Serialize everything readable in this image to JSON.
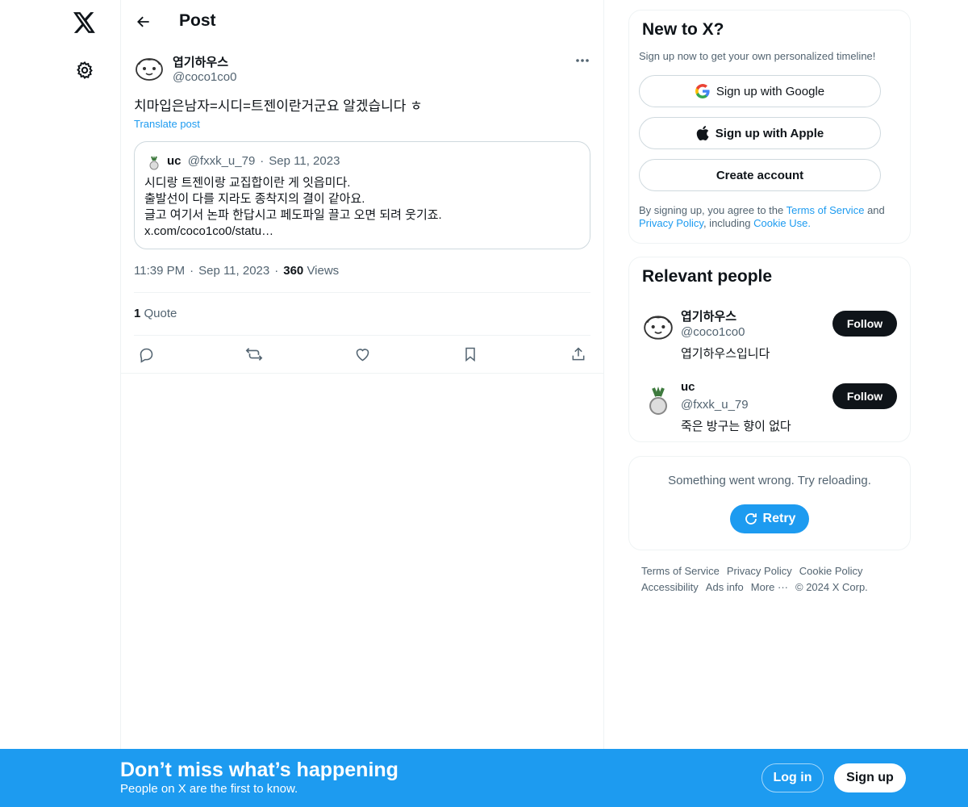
{
  "nav": {
    "logo_icon": "x-logo-icon",
    "settings_icon": "gear-icon"
  },
  "header": {
    "title": "Post"
  },
  "post": {
    "author_name": "엽기하우스",
    "author_handle": "@coco1co0",
    "text": "치마입은남자=시디=트젠이란거군요 알겠습니다 ㅎ",
    "translate": "Translate post",
    "quote": {
      "name": "uc",
      "handle": "@fxxk_u_79",
      "date": "Sep 11, 2023",
      "lines": [
        "시디랑 트젠이랑 교집합이란 게 잇읍미다.",
        "출발선이 다를 지라도 종착지의 결이 같아요.",
        "글고 여기서 논파 한답시고 페도파일 끌고 오면 되려 웃기죠.",
        "x.com/coco1co0/statu…"
      ]
    },
    "time": "11:39 PM",
    "date": "Sep 11, 2023",
    "views_count": "360",
    "views_label": "Views",
    "quotes_count": "1",
    "quotes_label": "Quote"
  },
  "signup_card": {
    "title": "New to X?",
    "subtitle": "Sign up now to get your own personalized timeline!",
    "google": "Sign up with Google",
    "apple": "Sign up with Apple",
    "create": "Create account",
    "legal_prefix": "By signing up, you agree to the",
    "terms": "Terms of Service",
    "and": "and",
    "privacy": "Privacy Policy",
    "including": ", including",
    "cookie": "Cookie Use."
  },
  "people": {
    "title": "Relevant people",
    "items": [
      {
        "name": "엽기하우스",
        "handle": "@coco1co0",
        "bio": "엽기하우스입니다",
        "button": "Follow"
      },
      {
        "name": "uc",
        "handle": "@fxxk_u_79",
        "bio": "죽은 방구는 향이 없다",
        "button": "Follow"
      }
    ]
  },
  "error_card": {
    "text": "Something went wrong. Try reloading.",
    "retry": "Retry"
  },
  "footer": {
    "links": [
      "Terms of Service",
      "Privacy Policy",
      "Cookie Policy",
      "Accessibility",
      "Ads info",
      "More ···"
    ],
    "copyright": "© 2024 X Corp."
  },
  "bottom_bar": {
    "title": "Don’t miss what’s happening",
    "subtitle": "People on X are the first to know.",
    "login": "Log in",
    "signup": "Sign up"
  },
  "colors": {
    "accent": "#1d9bf0",
    "text": "#0f1419",
    "secondary": "#536471",
    "border": "#eff3f4"
  }
}
